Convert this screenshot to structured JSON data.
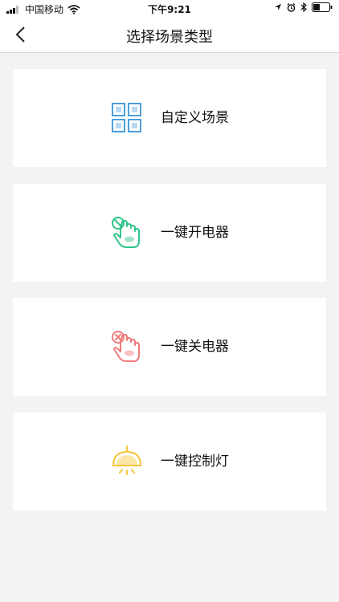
{
  "status_bar": {
    "carrier": "中国移动",
    "time": "下午9:21"
  },
  "header": {
    "title": "选择场景类型"
  },
  "scene_types": [
    {
      "label": "自定义场景",
      "icon": "grid-icon",
      "color": "#4a9fe0"
    },
    {
      "label": "一键开电器",
      "icon": "hand-power-on-icon",
      "color": "#2fc58a"
    },
    {
      "label": "一键关电器",
      "icon": "hand-power-off-icon",
      "color": "#f07a7a"
    },
    {
      "label": "一键控制灯",
      "icon": "lamp-icon",
      "color": "#f5c53a"
    }
  ]
}
